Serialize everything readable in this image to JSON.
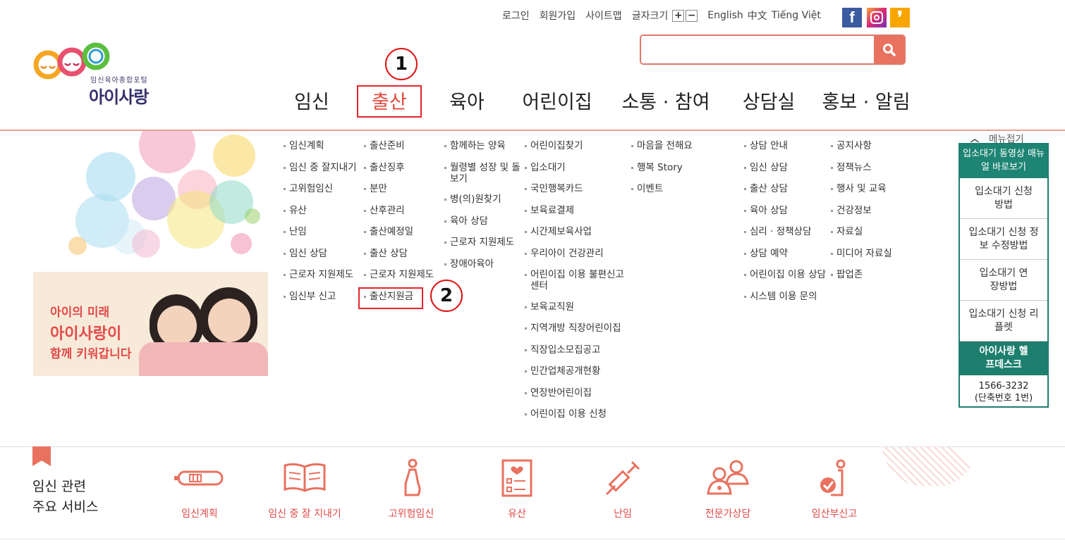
{
  "util": {
    "login": "로그인",
    "signup": "회원가입",
    "sitemap": "사이트맵",
    "fontsize": "글자크기",
    "plus": "+",
    "minus": "−",
    "lang_en": "English",
    "lang_zh": "中文",
    "lang_vi": "Tiếng Việt"
  },
  "sns": {
    "facebook": "f",
    "kakao": "❜"
  },
  "search": {
    "value": "",
    "placeholder": ""
  },
  "logo": {
    "sub": "임신육아종합포털",
    "main": "아이사랑"
  },
  "gnb": [
    "임신",
    "출산",
    "육아",
    "어린이집",
    "소통 · 참여",
    "상담실",
    "홍보 · 알림"
  ],
  "annotations": {
    "one": "1",
    "two": "2"
  },
  "promo": {
    "line1": "아이의 미래",
    "line2": "아이사랑이",
    "line3": "함께 키워갑니다"
  },
  "submenu": {
    "col1": [
      "임신계획",
      "임신 중 잘지내기",
      "고위험임신",
      "유산",
      "난임",
      "임신 상담",
      "근로자 지원제도",
      "임신부 신고"
    ],
    "col2": [
      "출산준비",
      "출산징후",
      "분만",
      "산후관리",
      "출산예정일",
      "출산 상담",
      "근로자 지원제도",
      "출산지원금"
    ],
    "col3": [
      "함께하는 양육",
      "월령별 성장 및 돌보기",
      "병(의)원찾기",
      "육아 상담",
      "근로자 지원제도",
      "장애아육아"
    ],
    "col4": [
      "어린이집찾기",
      "입소대기",
      "국민행복카드",
      "보육료결제",
      "시간제보육사업",
      "우리아이 건강관리",
      "어린이집 이용 불편신고센터",
      "보육교직원",
      "지역개방 직장어린이집",
      "직장입소모집공고",
      "민간업체공개현황",
      "연장반어린이집",
      "어린이집 이용 신청"
    ],
    "col5": [
      "마음을 전해요",
      "행복 Story",
      "이벤트"
    ],
    "col6": [
      "상담 안내",
      "임신 상담",
      "출산 상담",
      "육아 상담",
      "심리 · 정책상담",
      "상담 예약",
      "어린이집 이용 상담",
      "시스템 이용 문의"
    ],
    "col7": [
      "공지사항",
      "정책뉴스",
      "행사 및 교육",
      "건강정보",
      "자료실",
      "미디어 자료실",
      "팝업존"
    ]
  },
  "quick": {
    "fold": "메뉴접기",
    "top": "입소대기 동영상 매뉴얼 바로보기",
    "items": [
      "입소대기 신청방법",
      "입소대기 신청 정보 수정방법",
      "입소대기 연장방법",
      "입소대기 신청 리플렛"
    ],
    "helpdesk": "아이사랑 헬프데스크",
    "phone": "1566-3232",
    "phone_note": "(단축번호 1번)"
  },
  "services": {
    "title1": "임신 관련",
    "title2": "주요 서비스",
    "items": [
      "임신계획",
      "임신 중 잘 지내기",
      "고위험임신",
      "유산",
      "난임",
      "전문가상담",
      "임산부신고"
    ]
  },
  "colors": {
    "accent": "#e8725f",
    "teal": "#1e7f6e",
    "red": "#e3242b"
  }
}
